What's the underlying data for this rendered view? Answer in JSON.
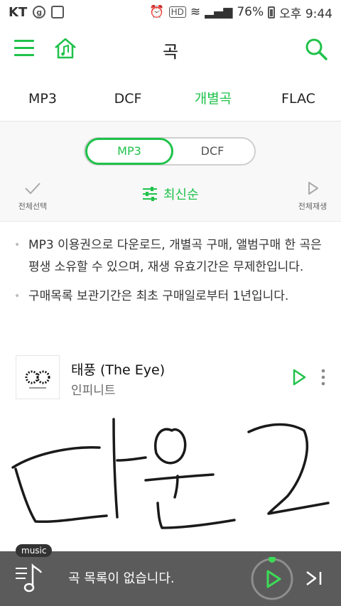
{
  "statusbar": {
    "carrier": "KT",
    "battery": "76%",
    "time": "오후 9:44"
  },
  "header": {
    "title": "곡"
  },
  "tabs": [
    {
      "label": "MP3"
    },
    {
      "label": "DCF"
    },
    {
      "label": "개별곡",
      "active": true
    },
    {
      "label": "FLAC"
    }
  ],
  "segment": {
    "mp3": "MP3",
    "dcf": "DCF"
  },
  "actions": {
    "select_all": "전체선택",
    "sort": "최신순",
    "play_all": "전체재생"
  },
  "notes": [
    "MP3 이용권으로 다운로드, 개별곡 구매, 앨범구매 한 곡은 평생 소유할 수 있으며, 재생 유효기간은 무제한입니다.",
    "구매목록 보관기간은 최초 구매일로부터 1년입니다."
  ],
  "track": {
    "title": "태풍 (The Eye)",
    "artist": "인피니트"
  },
  "player": {
    "badge": "music",
    "message": "곡 목록이 없습니다."
  },
  "colors": {
    "accent": "#1fc24a",
    "player_bg": "#5b5b5b"
  }
}
